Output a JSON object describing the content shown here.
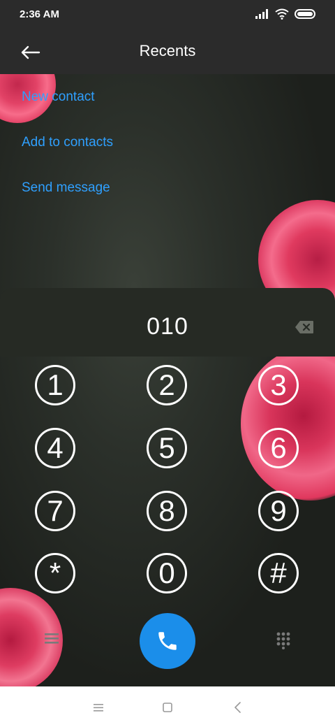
{
  "status_bar": {
    "time": "2:36 AM",
    "icons": [
      "signal-icon",
      "wifi-icon",
      "battery-icon"
    ]
  },
  "app_bar": {
    "title": "Recents",
    "back_icon": "back-arrow-icon"
  },
  "actions": [
    {
      "label": "New contact"
    },
    {
      "label": "Add to contacts"
    },
    {
      "label": "Send message"
    }
  ],
  "dial_input": {
    "value": "010",
    "backspace_icon": "backspace-icon"
  },
  "keypad": {
    "keys": [
      "1",
      "2",
      "3",
      "4",
      "5",
      "6",
      "7",
      "8",
      "9",
      "*",
      "0",
      "#"
    ]
  },
  "bottom_controls": {
    "menu_icon": "menu-icon",
    "call_icon": "phone-icon",
    "dialpad_icon": "dialpad-icon"
  },
  "nav_bar": {
    "icons": [
      "recent-apps-icon",
      "home-icon",
      "back-icon"
    ]
  },
  "colors": {
    "accent": "#2fa0ff",
    "call_button": "#1b8eea",
    "app_bar": "#2b2b2b"
  }
}
